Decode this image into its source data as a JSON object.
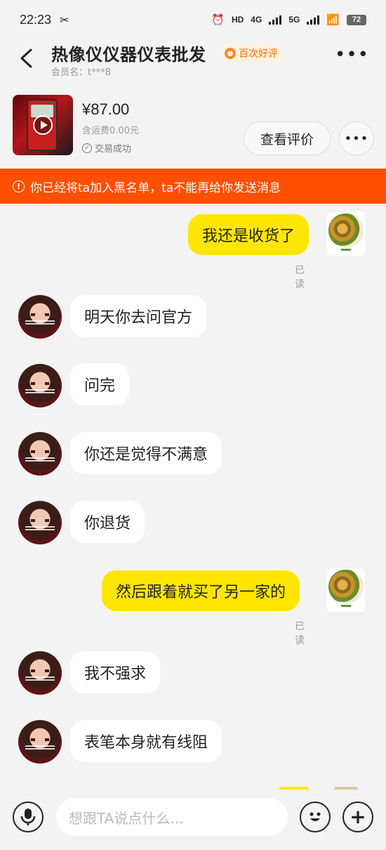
{
  "status_bar": {
    "time": "22:23",
    "battery": "72",
    "network_4g": "4G",
    "network_5g": "5G",
    "hd": "HD"
  },
  "header": {
    "title": "热像仪仪器仪表批发",
    "badge": "百次好评",
    "member": "会员名：t***8"
  },
  "product": {
    "price": "¥87.00",
    "shipping": "含运费0.00元",
    "deal_status": "交易成功",
    "review_button": "查看评价"
  },
  "notice": "你已经将ta加入黑名单，ta不能再给你发送消息",
  "messages": [
    {
      "side": "out",
      "text": "我还是收货了",
      "read": "已读"
    },
    {
      "side": "in",
      "text": "明天你去问官方"
    },
    {
      "side": "in",
      "text": "问完"
    },
    {
      "side": "in",
      "text": "你还是觉得不满意"
    },
    {
      "side": "in",
      "text": "你退货"
    },
    {
      "side": "out",
      "text": "然后跟着就买了另一家的",
      "read": "已读"
    },
    {
      "side": "in",
      "text": "我不强求"
    },
    {
      "side": "in",
      "text": "表笔本身就有线阻"
    }
  ],
  "input": {
    "placeholder": "想跟TA说点什么..."
  },
  "colors": {
    "accent_orange": "#ff4f00",
    "bubble_yellow": "#ffe600",
    "badge_orange": "#ff6a00"
  },
  "icons": [
    "back-icon",
    "more-icon",
    "play-icon",
    "check-icon",
    "warning-icon",
    "microphone-icon",
    "emoji-icon",
    "plus-icon"
  ]
}
